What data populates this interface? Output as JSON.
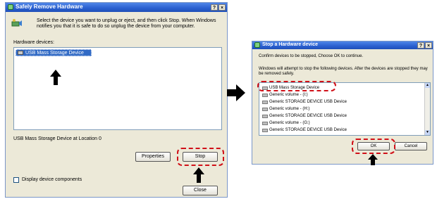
{
  "main_dialog": {
    "title": "Safely Remove Hardware",
    "help_btn": "?",
    "close_btn": "×",
    "instructions": "Select the device you want to unplug or eject, and then click Stop. When Windows notifies you that it is safe to do so unplug the device from your computer.",
    "hardware_devices_label": "Hardware devices:",
    "devices": [
      "USB Mass Storage Device"
    ],
    "status": "USB Mass Storage Device at Location 0",
    "properties_label": "Properties",
    "stop_label": "Stop",
    "checkbox_label": "Display device components",
    "close_label": "Close"
  },
  "stop_dialog": {
    "title": "Stop a Hardware device",
    "help_btn": "?",
    "close_btn": "×",
    "confirm_text": "Confirm devices to be stopped, Choose OK to continue.",
    "info_text": "Windows will attempt to stop the following devices. After the devices are stopped they may be removed safely.",
    "devices": [
      "USB Mass Storage Device",
      "Generic volume - (I:)",
      "Generic STORAGE DEVICE USB Device",
      "Generic volume - (H:)",
      "Generic STORAGE DEVICE USB Device",
      "Generic volume - (G:)",
      "Generic STORAGE DEVICE USB Device"
    ],
    "ok_label": "OK",
    "cancel_label": "Cancel"
  },
  "colors": {
    "highlight": "#d01018",
    "selection": "#316ac5",
    "titlebar": "#2a5fcf"
  }
}
